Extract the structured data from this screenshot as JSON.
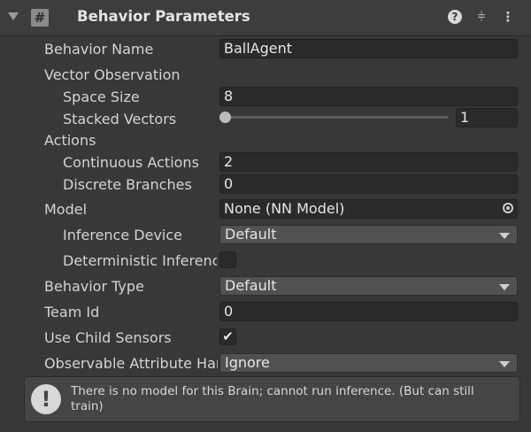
{
  "header": {
    "title": "Behavior Parameters",
    "script_icon": "#",
    "icons": [
      "chevron-down-icon",
      "script-icon",
      "help-icon",
      "preset-icon",
      "kebab-menu-icon"
    ]
  },
  "fields": {
    "behavior_name": {
      "label": "Behavior Name",
      "value": "BallAgent"
    },
    "vector_observation": {
      "label": "Vector Observation"
    },
    "space_size": {
      "label": "Space Size",
      "value": "8"
    },
    "stacked_vectors": {
      "label": "Stacked Vectors",
      "value": "1",
      "slider_fraction": 0
    },
    "actions": {
      "label": "Actions"
    },
    "continuous_actions": {
      "label": "Continuous Actions",
      "value": "2"
    },
    "discrete_branches": {
      "label": "Discrete Branches",
      "value": "0"
    },
    "model": {
      "label": "Model",
      "value": "None (NN Model)"
    },
    "inference_device": {
      "label": "Inference Device",
      "value": "Default"
    },
    "deterministic_inference": {
      "label": "Deterministic Inference",
      "checked": false
    },
    "behavior_type": {
      "label": "Behavior Type",
      "value": "Default"
    },
    "team_id": {
      "label": "Team Id",
      "value": "0"
    },
    "use_child_sensors": {
      "label": "Use Child Sensors",
      "checked": true
    },
    "observable_attribute_handling": {
      "label": "Observable Attribute Handling",
      "value": "Ignore"
    }
  },
  "helpbox": {
    "text": "There is no model for this Brain; cannot run inference. (But can still train)"
  },
  "colors": {
    "background": "#383838",
    "field": "#2a2a2a",
    "dropdown": "#515151"
  }
}
